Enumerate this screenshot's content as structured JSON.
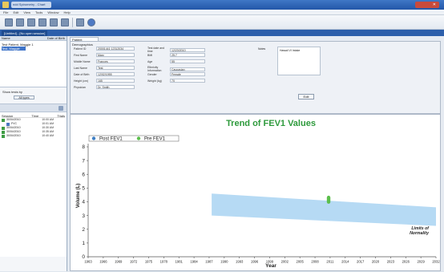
{
  "window": {
    "title": "ndd Spirometry - Chart"
  },
  "menu": [
    "File",
    "Edit",
    "View",
    "Tools",
    "Window",
    "Help"
  ],
  "tabs": {
    "active": "[Untitled] - [No open session]"
  },
  "left": {
    "header_left": "Name",
    "header_right": "Date of Birth",
    "tree": [
      {
        "label": "Test Patient, Maggie 1",
        "selected": false
      },
      {
        "label": "Test, Maggie",
        "selected": true
      }
    ],
    "filter_label": "Show tests by",
    "filter_button": "All types",
    "sessions_header": {
      "session": "Session",
      "time": "Time",
      "trials": "Trials"
    },
    "sessions": [
      {
        "label": "30/04/2010",
        "value": "10:00 AM"
      },
      {
        "label": "FVC",
        "value": "10:01 AM"
      },
      {
        "label": "30/04/2010",
        "value": "10:30 AM"
      },
      {
        "label": "30/04/2010",
        "value": "10:35 AM"
      },
      {
        "label": "30/04/2010",
        "value": "10:40 AM"
      }
    ]
  },
  "demographics": {
    "tab_label": "Patient Demographics",
    "fields_left": [
      {
        "label": "Patient ID",
        "value": "20001441 12312034"
      },
      {
        "label": "First Name",
        "value": "Mary"
      },
      {
        "label": "Middle Name",
        "value": "Frances"
      },
      {
        "label": "Last Name",
        "value": "Test"
      },
      {
        "label": "Date of Birth",
        "value": "12/02/1955"
      },
      {
        "label": "Height (cm)",
        "value": "165"
      },
      {
        "label": "Physician",
        "value": "Dr. Smith"
      }
    ],
    "fields_mid": [
      {
        "label": "Test date and time",
        "value": "12/23/2010"
      },
      {
        "label": "BMI",
        "value": "25.7"
      },
      {
        "label": "Age",
        "value": "55"
      },
      {
        "label": "Ethnicity Information",
        "value": "Caucasian"
      },
      {
        "label": "Gender",
        "value": "Female"
      },
      {
        "label": "Weight (kg)",
        "value": "70"
      }
    ],
    "notes_label": "Notes",
    "notes_value": "Hawaii VI Intake",
    "edit_button": "Edit"
  },
  "chart_data": {
    "type": "scatter",
    "title": "Trend of FEV1 Values",
    "xlabel": "Year",
    "ylabel": "Volume (L)",
    "xlim": [
      1963,
      2032
    ],
    "ylim": [
      0,
      8
    ],
    "xticks": [
      1963,
      1966,
      1969,
      1972,
      1975,
      1978,
      1981,
      1984,
      1987,
      1990,
      1993,
      1996,
      1999,
      2002,
      2005,
      2008,
      2011,
      2014,
      2017,
      2020,
      2023,
      2026,
      2029,
      2032
    ],
    "yticks": [
      0,
      1,
      2,
      3,
      4,
      5,
      6,
      7,
      8
    ],
    "series": [
      {
        "name": "Post FEV1",
        "color": "#3f7fc4",
        "points": []
      },
      {
        "name": "Pre FEV1",
        "color": "#5cbf4c",
        "points": [
          {
            "x": 2010.7,
            "y": 4.15
          }
        ]
      }
    ],
    "normality_band": {
      "label": "Limits of Normality",
      "color": "#a9d3f2",
      "x_start": 1987.5,
      "upper": [
        4.6,
        3.6
      ],
      "lower": [
        3.0,
        2.25
      ]
    },
    "legend": "top-left",
    "grid": false
  }
}
